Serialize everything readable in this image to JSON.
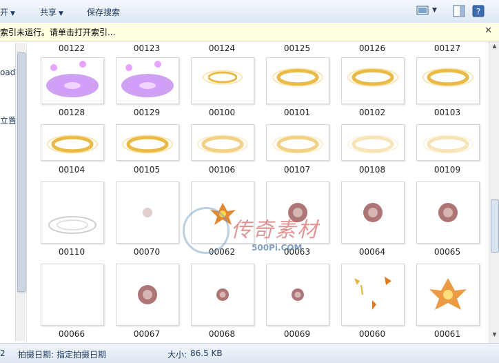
{
  "toolbar": {
    "open_label": "开",
    "share_label": "共享",
    "save_search_label": "保存搜索"
  },
  "infobar": {
    "message": "索引未运行。请单击打开索引..."
  },
  "nav": {
    "partial_items": [
      "oads",
      "立置"
    ]
  },
  "grid": {
    "rows": [
      [
        "00122",
        "00123",
        "00124",
        "00125",
        "00126",
        "00127"
      ],
      [
        "00128",
        "00129",
        "00100",
        "00101",
        "00102",
        "00103"
      ],
      [
        "00104",
        "00105",
        "00106",
        "00107",
        "00108",
        "00109"
      ],
      [
        "00110",
        "00070",
        "00062",
        "00063",
        "00064",
        "00065"
      ],
      [
        "00066",
        "00067",
        "00068",
        "00069",
        "00060",
        "00061"
      ]
    ]
  },
  "status": {
    "count": "2",
    "date_label": "拍摄日期:",
    "date_value": "指定拍摄日期",
    "size_label": "大小:",
    "size_value": "86.5 KB"
  },
  "watermark": {
    "text": "传奇素材",
    "url": "500Pi.COM"
  },
  "colors": {
    "purple": "#a653e8",
    "gold": "#e8b233",
    "smoke": "#8a3b3b"
  }
}
